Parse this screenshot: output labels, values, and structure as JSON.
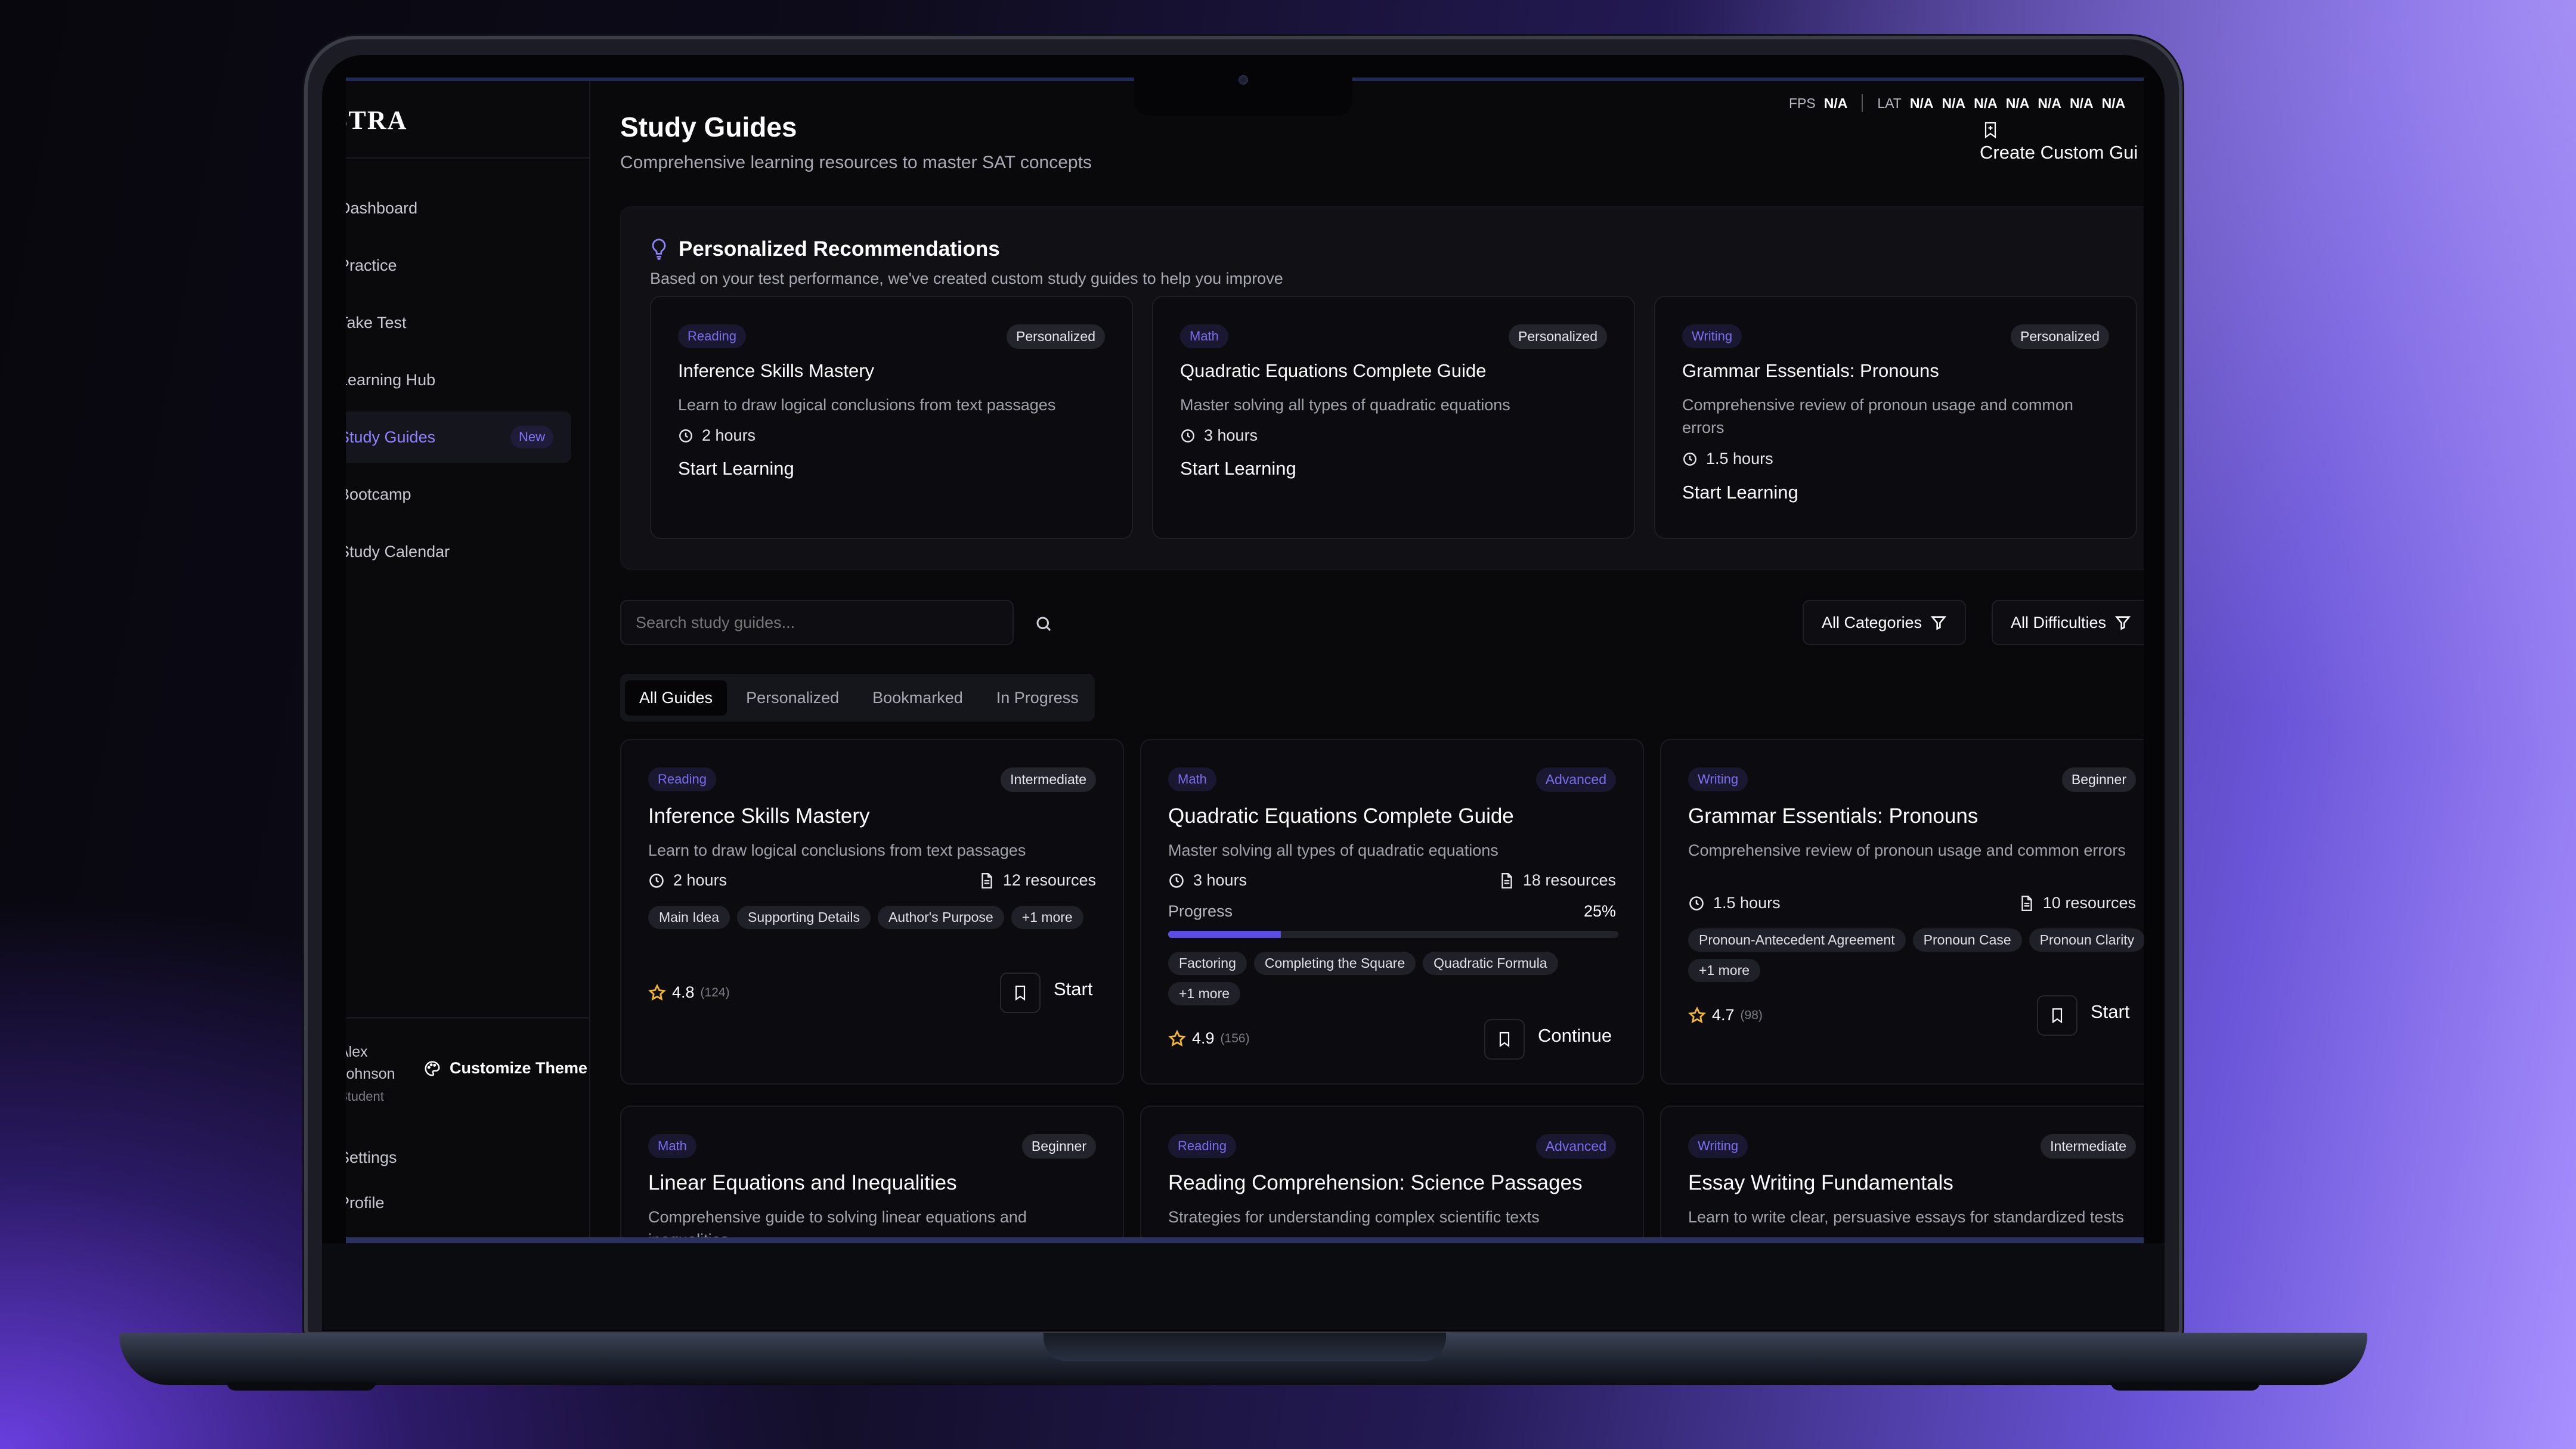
{
  "app": {
    "logo": "STRA"
  },
  "sidebar": {
    "items": [
      {
        "label": "Dashboard"
      },
      {
        "label": "Practice"
      },
      {
        "label": "Take Test"
      },
      {
        "label": "Learning Hub"
      },
      {
        "label": "Study Guides",
        "badge": "New",
        "active": true
      },
      {
        "label": "Bootcamp"
      },
      {
        "label": "Study Calendar"
      }
    ],
    "user": {
      "name_line1": "Alex",
      "name_line2": "Johnson",
      "role": "Student"
    },
    "theme_label": "Customize Theme",
    "settings_label": "Settings",
    "profile_label": "Profile"
  },
  "header": {
    "title": "Study Guides",
    "subtitle": "Comprehensive learning resources to master SAT concepts",
    "create_label": "Create Custom Gui",
    "fps_label": "FPS",
    "fps_value": "N/A",
    "lat_label": "LAT",
    "lat_values": [
      "N/A",
      "N/A",
      "N/A",
      "N/A",
      "N/A",
      "N/A",
      "N/A"
    ]
  },
  "recommendations": {
    "title": "Personalized Recommendations",
    "subtitle": "Based on your test performance, we've created custom study guides to help you improve",
    "cards": [
      {
        "category": "Reading",
        "tag": "Personalized",
        "title": "Inference Skills Mastery",
        "desc": "Learn to draw logical conclusions from text passages",
        "duration": "2 hours",
        "cta": "Start Learning"
      },
      {
        "category": "Math",
        "tag": "Personalized",
        "title": "Quadratic Equations Complete Guide",
        "desc": "Master solving all types of quadratic equations",
        "duration": "3 hours",
        "cta": "Start Learning"
      },
      {
        "category": "Writing",
        "tag": "Personalized",
        "title": "Grammar Essentials: Pronouns",
        "desc": "Comprehensive review of pronoun usage and common errors",
        "duration": "1.5 hours",
        "cta": "Start Learning"
      }
    ]
  },
  "search": {
    "placeholder": "Search study guides..."
  },
  "filters": {
    "categories": "All Categories",
    "difficulties": "All Difficulties"
  },
  "tabs": [
    "All Guides",
    "Personalized",
    "Bookmarked",
    "In Progress"
  ],
  "guides": [
    {
      "category": "Reading",
      "level": "Intermediate",
      "title": "Inference Skills Mastery",
      "desc": "Learn to draw logical conclusions from text passages",
      "duration": "2 hours",
      "resources": "12 resources",
      "chips": [
        "Main Idea",
        "Supporting Details",
        "Author's Purpose",
        "+1 more"
      ],
      "rating": "4.8",
      "reviews": "(124)",
      "action": "Start"
    },
    {
      "category": "Math",
      "level": "Advanced",
      "title": "Quadratic Equations Complete Guide",
      "desc": "Master solving all types of quadratic equations",
      "duration": "3 hours",
      "resources": "18 resources",
      "progress_label": "Progress",
      "progress_pct": "25%",
      "progress": 0.25,
      "chips": [
        "Factoring",
        "Completing the Square",
        "Quadratic Formula",
        "+1 more"
      ],
      "rating": "4.9",
      "reviews": "(156)",
      "action": "Continue"
    },
    {
      "category": "Writing",
      "level": "Beginner",
      "title": "Grammar Essentials: Pronouns",
      "desc": "Comprehensive review of pronoun usage and common errors",
      "duration": "1.5 hours",
      "resources": "10 resources",
      "chips": [
        "Pronoun-Antecedent Agreement",
        "Pronoun Case",
        "Pronoun Clarity",
        "+1 more"
      ],
      "rating": "4.7",
      "reviews": "(98)",
      "action": "Start"
    },
    {
      "category": "Math",
      "level": "Beginner",
      "title": "Linear Equations and Inequalities",
      "desc": "Comprehensive guide to solving linear equations and inequalities"
    },
    {
      "category": "Reading",
      "level": "Advanced",
      "title": "Reading Comprehension: Science Passages",
      "desc": "Strategies for understanding complex scientific texts"
    },
    {
      "category": "Writing",
      "level": "Intermediate",
      "title": "Essay Writing Fundamentals",
      "desc": "Learn to write clear, persuasive essays for standardized tests"
    }
  ],
  "colors": {
    "accent": "#5b4ee6",
    "accent_text": "#8f83ff",
    "star": "#f5b82e"
  }
}
